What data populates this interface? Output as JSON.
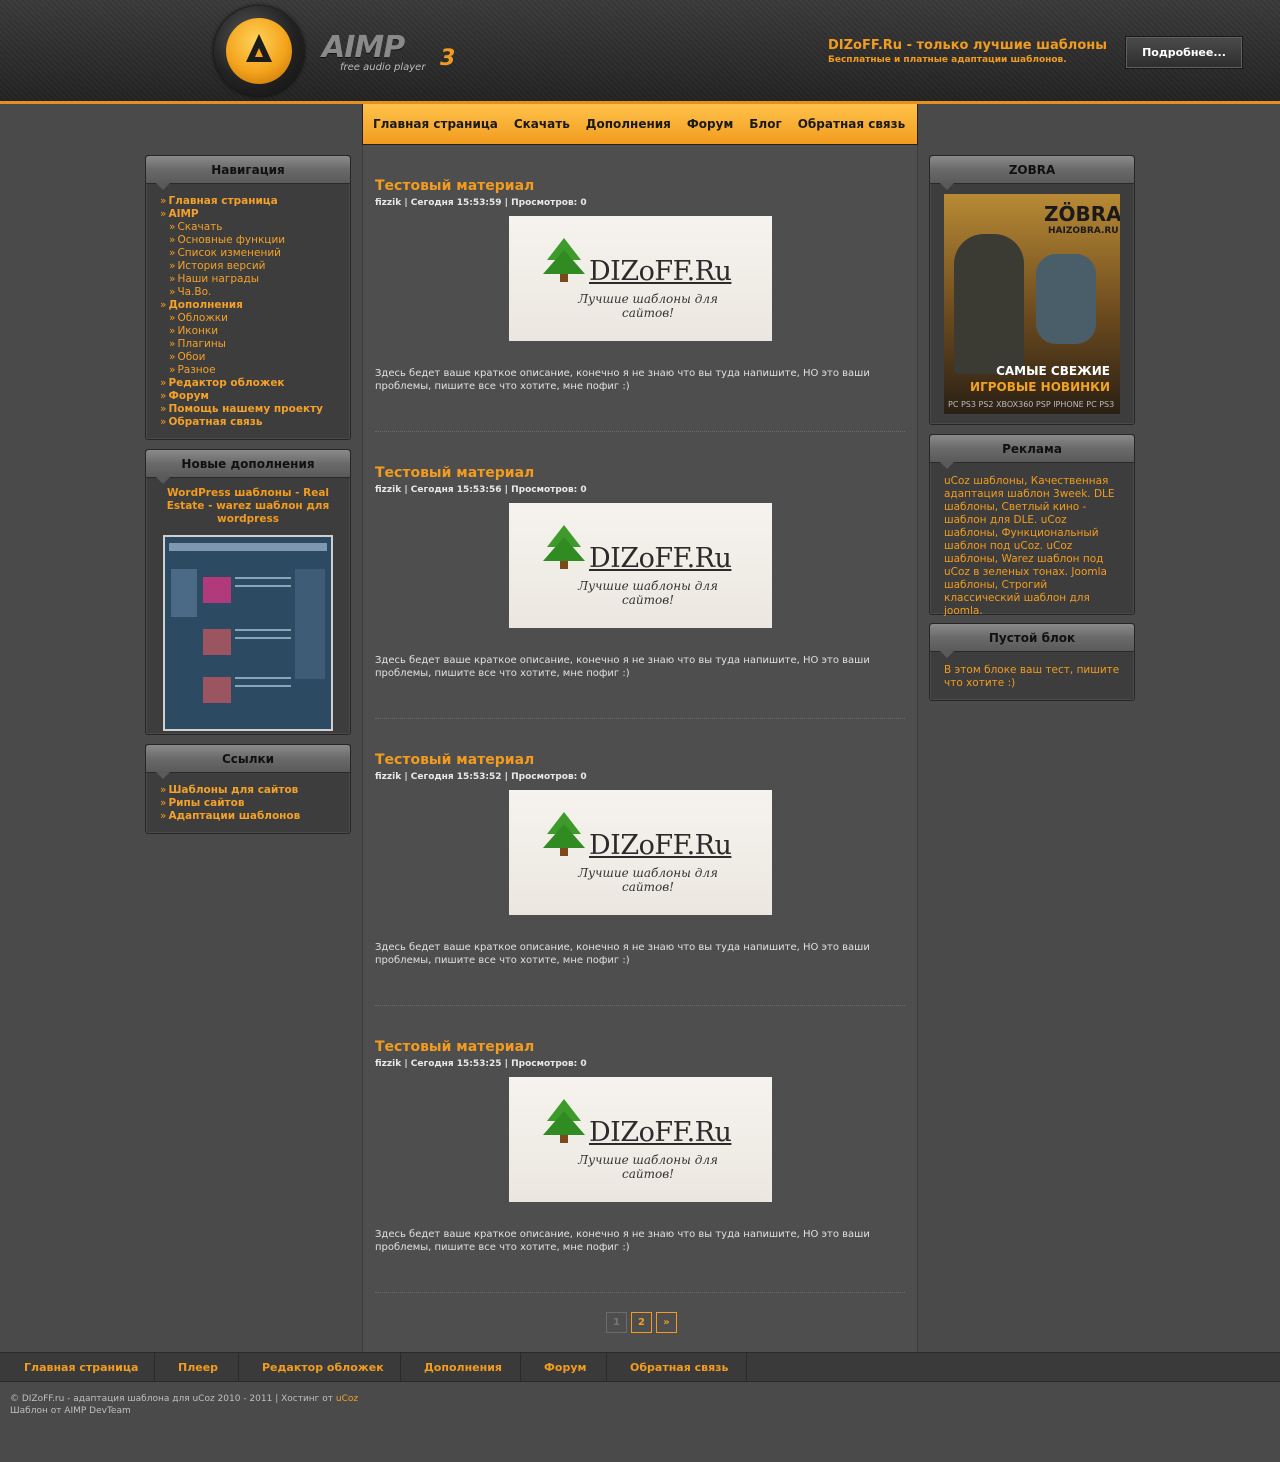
{
  "header": {
    "logo_word": "AIMP",
    "logo_version": "3",
    "logo_sub": "free audio player",
    "title": "DIZoFF.Ru - только лучшие шаблоны",
    "subtitle": "Бесплатные и платные адаптации шаблонов.",
    "more_button": "Подробнее..."
  },
  "mainmenu": [
    "Главная страница",
    "Скачать",
    "Дополнения",
    "Форум",
    "Блог",
    "Обратная связь"
  ],
  "posts": [
    {
      "title": "Тестовый материал",
      "author": "fizzik",
      "date": "Сегодня 15:53:59",
      "views": "Просмотров: 0"
    },
    {
      "title": "Тестовый материал",
      "author": "fizzik",
      "date": "Сегодня 15:53:56",
      "views": "Просмотров: 0"
    },
    {
      "title": "Тестовый материал",
      "author": "fizzik",
      "date": "Сегодня 15:53:52",
      "views": "Просмотров: 0"
    },
    {
      "title": "Тестовый материал",
      "author": "fizzik",
      "date": "Сегодня 15:53:25",
      "views": "Просмотров: 0"
    }
  ],
  "post_image": {
    "brand": "DIZoFF.Ru",
    "slogan": "Лучшие шаблоны для сайтов!"
  },
  "post_text": "Здесь бедет ваше краткое описание, конечно я не знаю что вы туда напишите, НО это ваши проблемы, пишите все что хотите, мне пофиг :)",
  "pager": {
    "page1": "1",
    "page2": "2",
    "next": "»"
  },
  "nav_block": {
    "title": "Навигация",
    "items": [
      {
        "label": "Главная страница",
        "level": 1
      },
      {
        "label": "AIMP",
        "level": 1
      },
      {
        "label": "Скачать",
        "level": 2
      },
      {
        "label": "Основные функции",
        "level": 2
      },
      {
        "label": "Список изменений",
        "level": 2
      },
      {
        "label": "История версий",
        "level": 2
      },
      {
        "label": "Наши награды",
        "level": 2
      },
      {
        "label": "Ча.Во.",
        "level": 2
      },
      {
        "label": "Дополнения",
        "level": 1
      },
      {
        "label": "Обложки",
        "level": 2
      },
      {
        "label": "Иконки",
        "level": 2
      },
      {
        "label": "Плагины",
        "level": 2
      },
      {
        "label": "Обои",
        "level": 2
      },
      {
        "label": "Разное",
        "level": 2
      },
      {
        "label": "Редактор обложек",
        "level": 1
      },
      {
        "label": "Форум",
        "level": 1
      },
      {
        "label": "Помощь нашему проекту",
        "level": 1
      },
      {
        "label": "Обратная связь",
        "level": 1
      }
    ]
  },
  "addons_block": {
    "title": "Новые дополнения",
    "item_title": "WordPress шаблоны - Real Estate - warez шаблон для wordpress"
  },
  "links_block": {
    "title": "Ссылки",
    "items": [
      "Шаблоны для сайтов",
      "Рипы сайтов",
      "Адаптации шаблонов"
    ]
  },
  "zobra_block": {
    "title": "ZOBRA",
    "logo": "ZÖBRA",
    "url": "HAIZOBRA.RU",
    "line1": "САМЫЕ СВЕЖИЕ",
    "line2": "ИГРОВЫЕ НОВИНКИ",
    "platforms": "PC PS3 PS2 XBOX360 PSP IPHONE PC PS3"
  },
  "ads_block": {
    "title": "Реклама",
    "text": "uCoz шаблоны, Качественная адаптация шаблон 3week. DLE шаблоны, Светлый кино - шаблон для DLE. uCoz шаблоны, Функциональный шаблон под uCoz. uCoz шаблоны, Warez шаблон под uCoz в зеленых тонах. Joomla шаблоны, Строгий классический шаблон для joomla."
  },
  "empty_block": {
    "title": "Пустой блок",
    "text": "В этом блоке ваш тест, пишите что хотите :)"
  },
  "footer": {
    "nav": [
      "Главная страница",
      "Плеер",
      "Редактор обложек",
      "Дополнения",
      "Форум",
      "Обратная связь"
    ],
    "copyright": "© DIZoFF.ru - адаптация шаблона для uCoz 2010 - 2011 | Хостинг от",
    "host_link": "uCoz",
    "credit": "Шаблон от AIMP DevTeam"
  },
  "colors": {
    "accent": "#f29c1f",
    "background": "#4a4a4a",
    "block": "#3d3d3d"
  }
}
